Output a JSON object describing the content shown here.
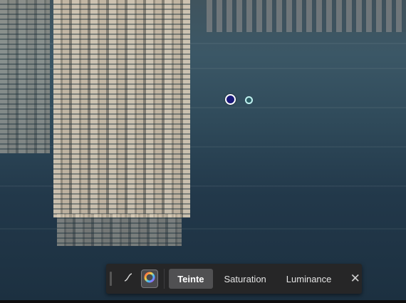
{
  "editor": {
    "image_description_hidden": "",
    "colors": {
      "marker_fill": "#1b1a7a",
      "marker_border": "#ffffff",
      "secondary_marker_border": "#bff1ef",
      "toolbar_bg": "#262627",
      "selected_tab_bg": "#505052"
    }
  },
  "toolbar": {
    "curve_icon": "curve-icon",
    "color_wheel_icon": "color-wheel-icon",
    "tabs": [
      {
        "label": "Teinte",
        "selected": true
      },
      {
        "label": "Saturation",
        "selected": false
      },
      {
        "label": "Luminance",
        "selected": false
      }
    ],
    "close_label": "✕"
  }
}
